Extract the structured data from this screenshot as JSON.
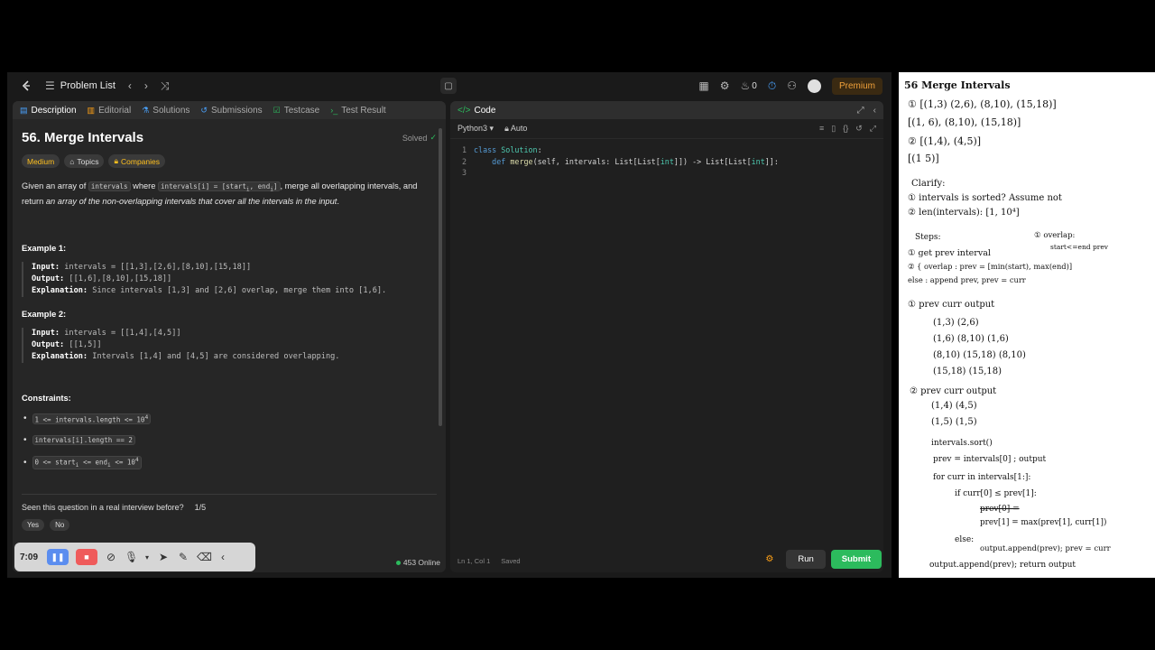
{
  "topbar": {
    "problem_list": "Problem List",
    "premium": "Premium",
    "streak": "0"
  },
  "tabs": [
    {
      "label": "Description",
      "icon": "document-icon"
    },
    {
      "label": "Editorial",
      "icon": "book-icon"
    },
    {
      "label": "Solutions",
      "icon": "flask-icon"
    },
    {
      "label": "Submissions",
      "icon": "history-icon"
    },
    {
      "label": "Testcase",
      "icon": "checkbox-icon"
    },
    {
      "label": "Test Result",
      "icon": "terminal-icon"
    }
  ],
  "problem": {
    "title": "56. Merge Intervals",
    "status": "Solved",
    "difficulty": "Medium",
    "topics": "Topics",
    "companies": "Companies",
    "desc_1": "Given an array of ",
    "desc_code1": "intervals",
    "desc_2": " where ",
    "desc_code2": "intervals[i] = [start",
    "desc_code2_sub1": "i",
    "desc_code2_mid": ", end",
    "desc_code2_sub2": "i",
    "desc_code2_end": "]",
    "desc_3": ", merge all overlapping intervals, and return ",
    "desc_em": "an array of the non-overlapping intervals that cover all the intervals in the input",
    "desc_4": ".",
    "examples": [
      {
        "heading": "Example 1:",
        "input_label": "Input:",
        "input": " intervals = [[1,3],[2,6],[8,10],[15,18]]",
        "output_label": "Output:",
        "output": " [[1,6],[8,10],[15,18]]",
        "expl_label": "Explanation:",
        "expl": " Since intervals [1,3] and [2,6] overlap, merge them into [1,6]."
      },
      {
        "heading": "Example 2:",
        "input_label": "Input:",
        "input": " intervals = [[1,4],[4,5]]",
        "output_label": "Output:",
        "output": " [[1,5]]",
        "expl_label": "Explanation:",
        "expl": " Intervals [1,4] and [4,5] are considered overlapping."
      }
    ],
    "constraints_heading": "Constraints:",
    "constraints": [
      {
        "a": "1 <= intervals.length <= 10",
        "sup": "4",
        "b": ""
      },
      {
        "a": "intervals[i].length == 2",
        "sup": "",
        "b": ""
      },
      {
        "a": "0 <= start",
        "sub1": "i",
        "mid": " <= end",
        "sub2": "i",
        "b": " <= 10",
        "sup": "4"
      }
    ],
    "interview_q": "Seen this question in a real interview before?",
    "interview_page": "1/5",
    "yes": "Yes",
    "no": "No",
    "online": "453 Online"
  },
  "recorder": {
    "time": "7:09"
  },
  "code": {
    "header": "Code",
    "language": "Python3",
    "mode": "Auto",
    "lines": [
      {
        "n": "1",
        "text": "class Solution:"
      },
      {
        "n": "2",
        "text": "    def merge(self, intervals: List[List[int]]) -> List[List[int]]:"
      },
      {
        "n": "3",
        "text": ""
      }
    ],
    "cursor": "Ln 1, Col 1",
    "saved": "Saved",
    "run": "Run",
    "submit": "Submit"
  },
  "notes": [
    "56  Merge Intervals",
    "① [(1,3) (2,6), (8,10), (15,18)]",
    "   [(1,        6), (8,10), (15,18)]",
    "② [(1,4), (4,5)]",
    "   [(1          5)]",
    "Clarify:",
    "① intervals is sorted?  Assume not",
    "② len(intervals): [1, 10⁴]",
    "Steps:",
    "① overlap:",
    "① get prev interval",
    "start<=end prev",
    "② { overlap : prev = [min(start), max(end)]",
    "     else    : append prev, prev = curr",
    "① prev    curr    output",
    "(1,3)    (2,6)",
    "(1,6)    (8,10)    (1,6)",
    "(8,10)   (15,18)   (8,10)",
    "(15,18)             (15,18)",
    "② prev    curr    output",
    "(1,4)    (4,5)",
    "(1,5)               (1,5)",
    "intervals.sort()",
    "prev = intervals[0] ; output",
    "for curr in intervals[1:]:",
    "if curr[0] ≤ prev[1]:",
    "prev[0] =",
    "prev[1] = max(prev[1], curr[1])",
    "else:",
    "output.append(prev); prev = curr",
    "output.append(prev); return output"
  ]
}
